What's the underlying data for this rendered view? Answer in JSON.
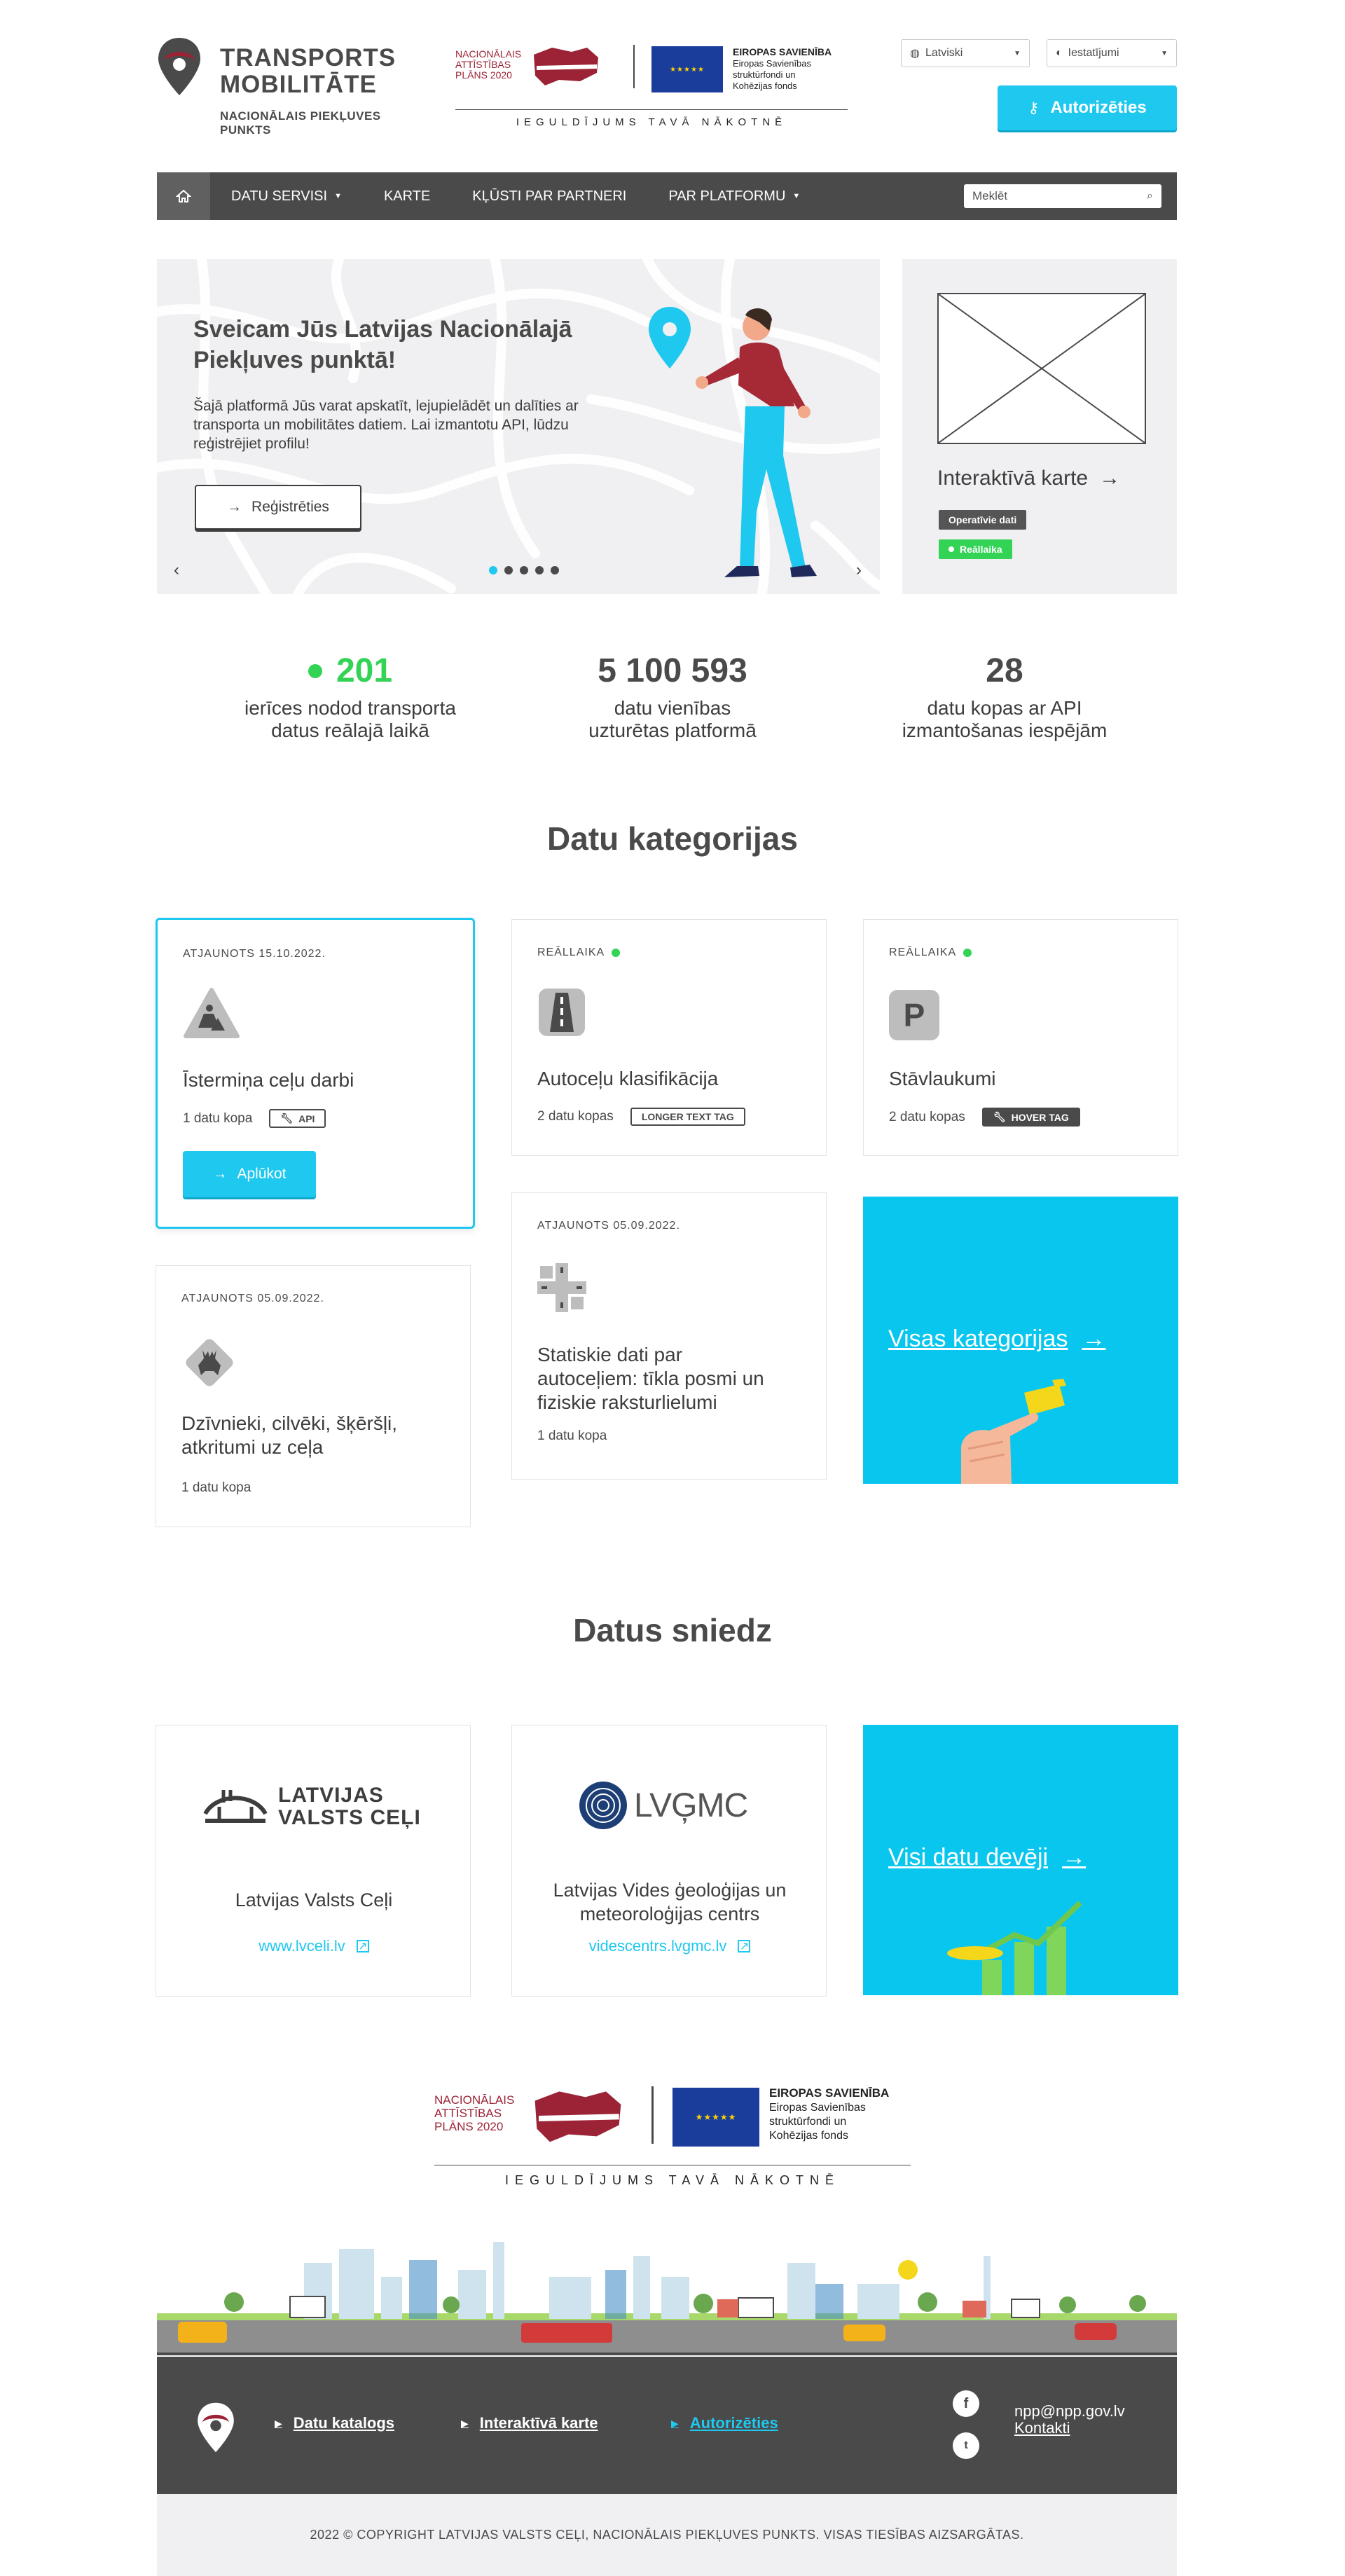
{
  "header": {
    "logo_line1": "TRANSPORTS",
    "logo_line2": "MOBILITĀTE",
    "logo_sub1": "NACIONĀLAIS PIEKĻUVES",
    "logo_sub2": "PUNKTS",
    "language": "Latviski",
    "settings": "Iestatījumi",
    "auth_button": "Autorizēties"
  },
  "eu_banner": {
    "nap_line1": "NACIONĀLAIS",
    "nap_line2": "ATTĪSTĪBAS",
    "nap_line3": "PLĀNS 2020",
    "eu_title": "EIROPAS SAVIENĪBA",
    "eu_line1": "Eiropas Savienības",
    "eu_line2": "struktūrfondi un",
    "eu_line3": "Kohēzijas fonds",
    "slogan": "IEGULDĪJUMS TAVĀ NĀKOTNĒ"
  },
  "nav": {
    "items": [
      {
        "label": "DATU SERVISI",
        "dropdown": true
      },
      {
        "label": "KARTE",
        "dropdown": false
      },
      {
        "label": "KĻŪSTI PAR PARTNERI",
        "dropdown": false
      },
      {
        "label": "PAR PLATFORMU",
        "dropdown": true
      }
    ],
    "search_placeholder": "Meklēt"
  },
  "hero": {
    "title": "Sveicam Jūs Latvijas Nacionālajā Piekļuves punktā!",
    "text": "Šajā platformā Jūs varat apskatīt, lejupielādēt un dalīties ar transporta un mobilitātes datiem. Lai izmantotu API, lūdzu reģistrējiet profilu!",
    "button": "Reģistrēties",
    "slides": 5,
    "active_slide": 1
  },
  "map_card": {
    "title": "Interaktīvā karte",
    "tag_operative": "Operatīvie dati",
    "tag_realtime": "Reāllaika"
  },
  "stats": [
    {
      "value": "201",
      "label1": "ierīces nodod transporta",
      "label2": "datus reālajā laikā",
      "live": true
    },
    {
      "value": "5 100 593",
      "label1": "datu vienības",
      "label2": "uzturētas platformā",
      "live": false
    },
    {
      "value": "28",
      "label1": "datu kopas ar API",
      "label2": "izmantošanas iespējām",
      "live": false
    }
  ],
  "categories_title": "Datu kategorijas",
  "categories": [
    {
      "label": "ATJAUNOTS 15.10.2022.",
      "title": "Īstermiņa ceļu darbi",
      "count": "1 datu kopa",
      "tag": "API",
      "button": "Aplūkot"
    },
    {
      "label": "REĀLLAIKA",
      "title": "Autoceļu klasifikācija",
      "count": "2 datu kopas",
      "tag": "LONGER TEXT TAG"
    },
    {
      "label": "REĀLLAIKA",
      "title": "Stāvlaukumi",
      "count": "2 datu kopas",
      "tag": "HOVER TAG"
    },
    {
      "label": "ATJAUNOTS 05.09.2022.",
      "title_line1": "Dzīvnieki, cilvēki, šķēršļi,",
      "title_line2": "atkritumi uz ceļa",
      "count": "1 datu kopa"
    },
    {
      "label": "ATJAUNOTS 05.09.2022.",
      "title_line1": "Statiskie dati par",
      "title_line2": "autoceļiem: tīkla posmi un",
      "title_line3": "fiziskie raksturlielumi",
      "count": "1 datu kopa"
    }
  ],
  "all_categories": "Visas kategorijas",
  "providers_title": "Datus sniedz",
  "providers": [
    {
      "logo_line1": "LATVIJAS",
      "logo_line2": "VALSTS CEĻI",
      "name": "Latvijas Valsts Ceļi",
      "link": "www.lvceli.lv"
    },
    {
      "logo": "LVĢMC",
      "name_line1": "Latvijas Vides ģeoloģijas un",
      "name_line2": "meteoroloģijas centrs",
      "link": "videscentrs.lvgmc.lv"
    }
  ],
  "all_providers": "Visi datu devēji",
  "footer": {
    "links": [
      "Datu katalogs",
      "Interaktīvā karte",
      "Autorizēties"
    ],
    "email": "npp@npp.gov.lv",
    "contacts": "Kontakti",
    "copyright": "2022 © COPYRIGHT LATVIJAS VALSTS CEĻI, NACIONĀLAIS PIEKĻUVES PUNKTS. VISAS TIESĪBAS AIZSARGĀTAS."
  },
  "colors": {
    "accent": "#1ec8ef",
    "dark": "#4a4a4a",
    "green": "#33d356",
    "brand_red": "#9b2335"
  }
}
